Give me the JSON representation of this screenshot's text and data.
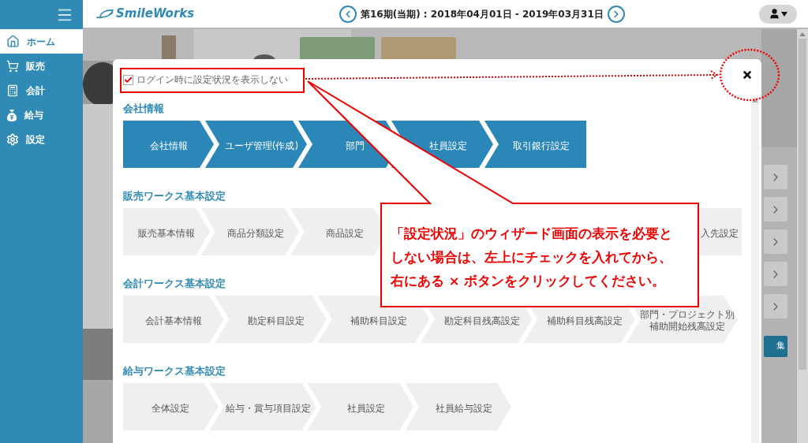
{
  "sidebar": {
    "items": [
      {
        "label": "ホーム",
        "selected": true
      },
      {
        "label": "販売",
        "selected": false
      },
      {
        "label": "会計",
        "selected": false
      },
      {
        "label": "給与",
        "selected": false
      },
      {
        "label": "設定",
        "selected": false
      }
    ]
  },
  "header": {
    "logo": "SmileWorks",
    "period": "第16期(当期) : 2018年04月01日 - 2019年03月31日"
  },
  "background": {
    "edit_button": "集"
  },
  "dialog": {
    "hide_on_login": {
      "label": "ログイン時に設定状況を表示しない",
      "checked": true
    },
    "sections": [
      {
        "title": "会社情報",
        "kind": "active",
        "steps": [
          {
            "label": "会社情報",
            "kind": "step"
          },
          {
            "label": "ユーザ管理(作成)",
            "kind": "step"
          },
          {
            "label": "部門",
            "kind": "step"
          },
          {
            "label": "社員設定",
            "kind": "step"
          },
          {
            "label": "取引銀行設定",
            "kind": "step"
          }
        ]
      },
      {
        "title": "販売ワークス基本設定",
        "kind": "pending",
        "steps": [
          {
            "label": "販売基本情報",
            "kind": "step"
          },
          {
            "label": "商品分類設定",
            "kind": "step"
          },
          {
            "label": "商品設定",
            "kind": "step"
          },
          {
            "label": "入先設定",
            "kind": "partial"
          }
        ]
      },
      {
        "title": "会計ワークス基本設定",
        "kind": "pending",
        "steps": [
          {
            "label": "会計基本情報",
            "kind": "step"
          },
          {
            "label": "勘定科目設定",
            "kind": "step"
          },
          {
            "label": "補助科目設定",
            "kind": "step"
          },
          {
            "label": "勘定科目残高設定",
            "kind": "step"
          },
          {
            "label": "補助科目残高設定",
            "kind": "step"
          },
          {
            "lines": [
              "部門・プロジェクト別",
              "補助開始残高設定"
            ],
            "kind": "two_line"
          }
        ]
      },
      {
        "title": "給与ワークス基本設定",
        "kind": "pending",
        "steps": [
          {
            "label": "全体設定",
            "kind": "step"
          },
          {
            "label": "給与・賞与項目設定",
            "kind": "step"
          },
          {
            "label": "社員設定",
            "kind": "step"
          },
          {
            "label": "社員給与設定",
            "kind": "step"
          }
        ]
      }
    ]
  },
  "annotation": {
    "lines": [
      "「設定状況」のウィザード画面の表示を必要と",
      "しない場合は、左上にチェックを入れてから、",
      "右にある × ボタンをクリックしてください。"
    ]
  }
}
